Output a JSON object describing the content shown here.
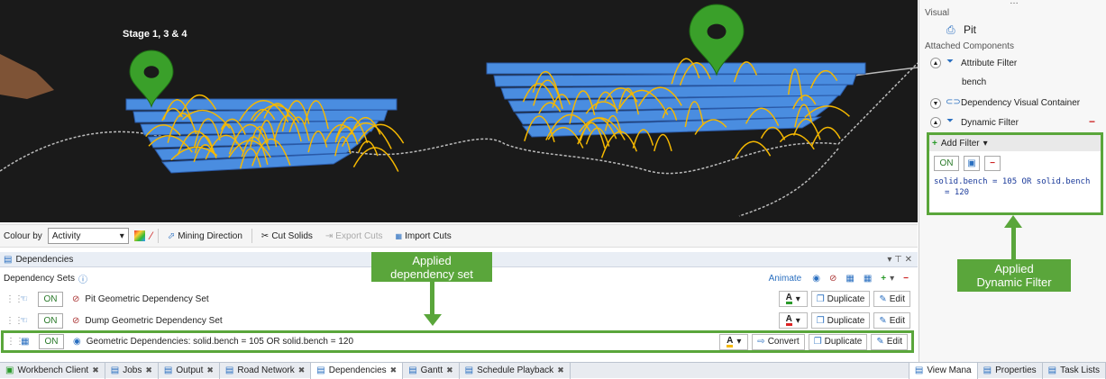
{
  "viewport": {
    "stage_label": "Stage 1, 3 & 4"
  },
  "viewport_toolbar": {
    "colour_by_label": "Colour by",
    "colour_by_value": "Activity",
    "mining_direction": "Mining Direction",
    "cut_solids": "Cut Solids",
    "export_cuts": "Export Cuts",
    "import_cuts": "Import Cuts"
  },
  "dependencies_panel": {
    "title": "Dependencies",
    "sets_label": "Dependency Sets",
    "animate": "Animate",
    "rows": [
      {
        "on": "ON",
        "name": "Pit Geometric Dependency Set",
        "duplicate": "Duplicate",
        "edit": "Edit"
      },
      {
        "on": "ON",
        "name": "Dump Geometric Dependency Set",
        "duplicate": "Duplicate",
        "edit": "Edit"
      },
      {
        "on": "ON",
        "name": "Geometric Dependencies: solid.bench = 105 OR solid.bench = 120",
        "convert": "Convert",
        "duplicate": "Duplicate",
        "edit": "Edit"
      }
    ],
    "color_letter": "A"
  },
  "callouts": {
    "applied_dependency_set_line1": "Applied",
    "applied_dependency_set_line2": "dependency set",
    "applied_dynamic_filter_line1": "Applied",
    "applied_dynamic_filter_line2": "Dynamic Filter"
  },
  "bottom_tabs": [
    {
      "label": "Workbench Client"
    },
    {
      "label": "Jobs"
    },
    {
      "label": "Output"
    },
    {
      "label": "Road Network"
    },
    {
      "label": "Dependencies"
    },
    {
      "label": "Gantt"
    },
    {
      "label": "Schedule Playback"
    }
  ],
  "right_tabs": [
    {
      "label": "View Mana"
    },
    {
      "label": "Properties"
    },
    {
      "label": "Task Lists"
    }
  ],
  "right_panel": {
    "visual_label": "Visual",
    "pit_label": "Pit",
    "attached_components": "Attached Components",
    "attribute_filter": "Attribute Filter",
    "bench": "bench",
    "dependency_visual_container": "Dependency Visual Container",
    "dynamic_filter": "Dynamic Filter",
    "add_filter": "Add Filter",
    "on": "ON",
    "expr_part1": "solid.bench = 105 OR solid.bench",
    "expr_part2": "= 120"
  },
  "colors": {
    "accent_green": "#5aa63b",
    "solid_blue": "#4a8de0",
    "arc_yellow": "#f5b800",
    "pin_green": "#3aa02a"
  }
}
